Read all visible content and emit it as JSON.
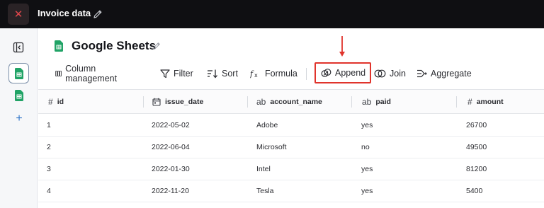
{
  "header": {
    "title": "Invoice data",
    "close_icon": "close-icon",
    "edit_icon": "pencil-icon"
  },
  "sidebar": {
    "collapse_icon": "sidebar-collapse-icon",
    "sources": [
      "google-sheets-icon",
      "google-sheets-icon"
    ],
    "add_icon": "plus-icon"
  },
  "page": {
    "title": "Google Sheets",
    "edit_icon": "pencil-icon"
  },
  "toolbar": {
    "column_management": "Column management",
    "filter": "Filter",
    "sort": "Sort",
    "formula": "Formula",
    "append": "Append",
    "join": "Join",
    "aggregate": "Aggregate"
  },
  "annotation": {
    "highlight_color": "#e0342c",
    "target": "append"
  },
  "table": {
    "columns": [
      {
        "type": "#",
        "name": "id"
      },
      {
        "type": "calendar-icon",
        "name": "issue_date"
      },
      {
        "type": "ab",
        "name": "account_name"
      },
      {
        "type": "ab",
        "name": "paid"
      },
      {
        "type": "#",
        "name": "amount"
      }
    ],
    "rows": [
      [
        "1",
        "2022-05-02",
        "Adobe",
        "yes",
        "26700"
      ],
      [
        "2",
        "2022-06-04",
        "Microsoft",
        "no",
        "49500"
      ],
      [
        "3",
        "2022-01-30",
        "Intel",
        "yes",
        "81200"
      ],
      [
        "4",
        "2022-11-20",
        "Tesla",
        "yes",
        "5400"
      ]
    ]
  },
  "colors": {
    "topbar": "#0f0f12",
    "sheets_green": "#21a366",
    "close_red": "#e0474c"
  }
}
